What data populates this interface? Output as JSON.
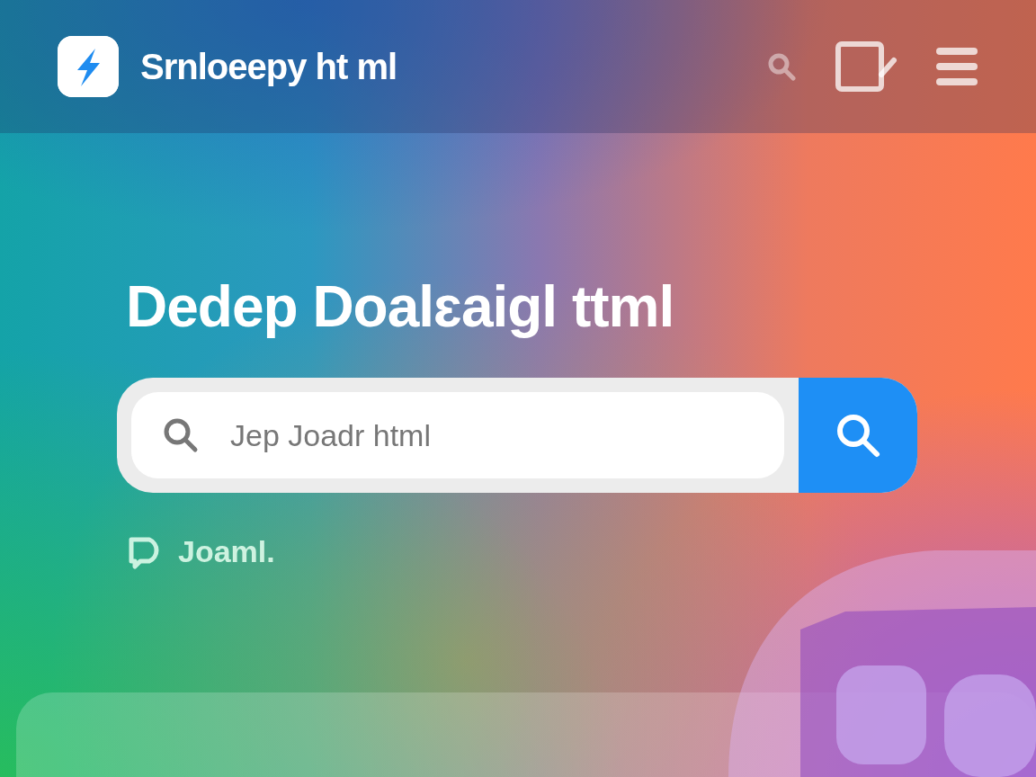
{
  "header": {
    "logo_text": "Srnloeepy ht ml"
  },
  "hero": {
    "title": "Dedep Doalɛaigl ttml",
    "search": {
      "placeholder": "Jep Joadr html"
    }
  },
  "link": {
    "label": "Joaml."
  }
}
